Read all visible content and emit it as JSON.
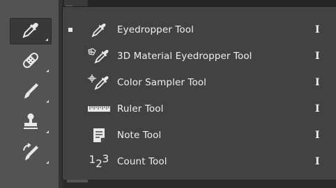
{
  "toolbar": {
    "tools": [
      {
        "name": "eyedropper-tool-button",
        "icon": "eyedropper-icon",
        "active": true
      },
      {
        "name": "spot-healing-tool-button",
        "icon": "bandage-icon",
        "active": false
      },
      {
        "name": "brush-tool-button",
        "icon": "brush-icon",
        "active": false
      },
      {
        "name": "clone-stamp-tool-button",
        "icon": "stamp-icon",
        "active": false
      },
      {
        "name": "history-brush-tool-button",
        "icon": "history-brush-icon",
        "active": false
      }
    ]
  },
  "flyout": {
    "items": [
      {
        "label": "Eyedropper Tool",
        "shortcut": "I",
        "icon": "eyedropper-icon",
        "selected": true
      },
      {
        "label": "3D Material Eyedropper Tool",
        "shortcut": "I",
        "icon": "3d-material-eyedropper-icon",
        "selected": false
      },
      {
        "label": "Color Sampler Tool",
        "shortcut": "I",
        "icon": "color-sampler-icon",
        "selected": false
      },
      {
        "label": "Ruler Tool",
        "shortcut": "I",
        "icon": "ruler-icon",
        "selected": false
      },
      {
        "label": "Note Tool",
        "shortcut": "I",
        "icon": "note-icon",
        "selected": false
      },
      {
        "label": "Count Tool",
        "shortcut": "I",
        "icon": "count-icon",
        "selected": false
      }
    ],
    "count_icon_digits": [
      "1",
      "2",
      "3"
    ]
  },
  "colors": {
    "toolbar_bg": "#535353",
    "menu_bg": "#424242",
    "text": "#f0f0f0"
  }
}
